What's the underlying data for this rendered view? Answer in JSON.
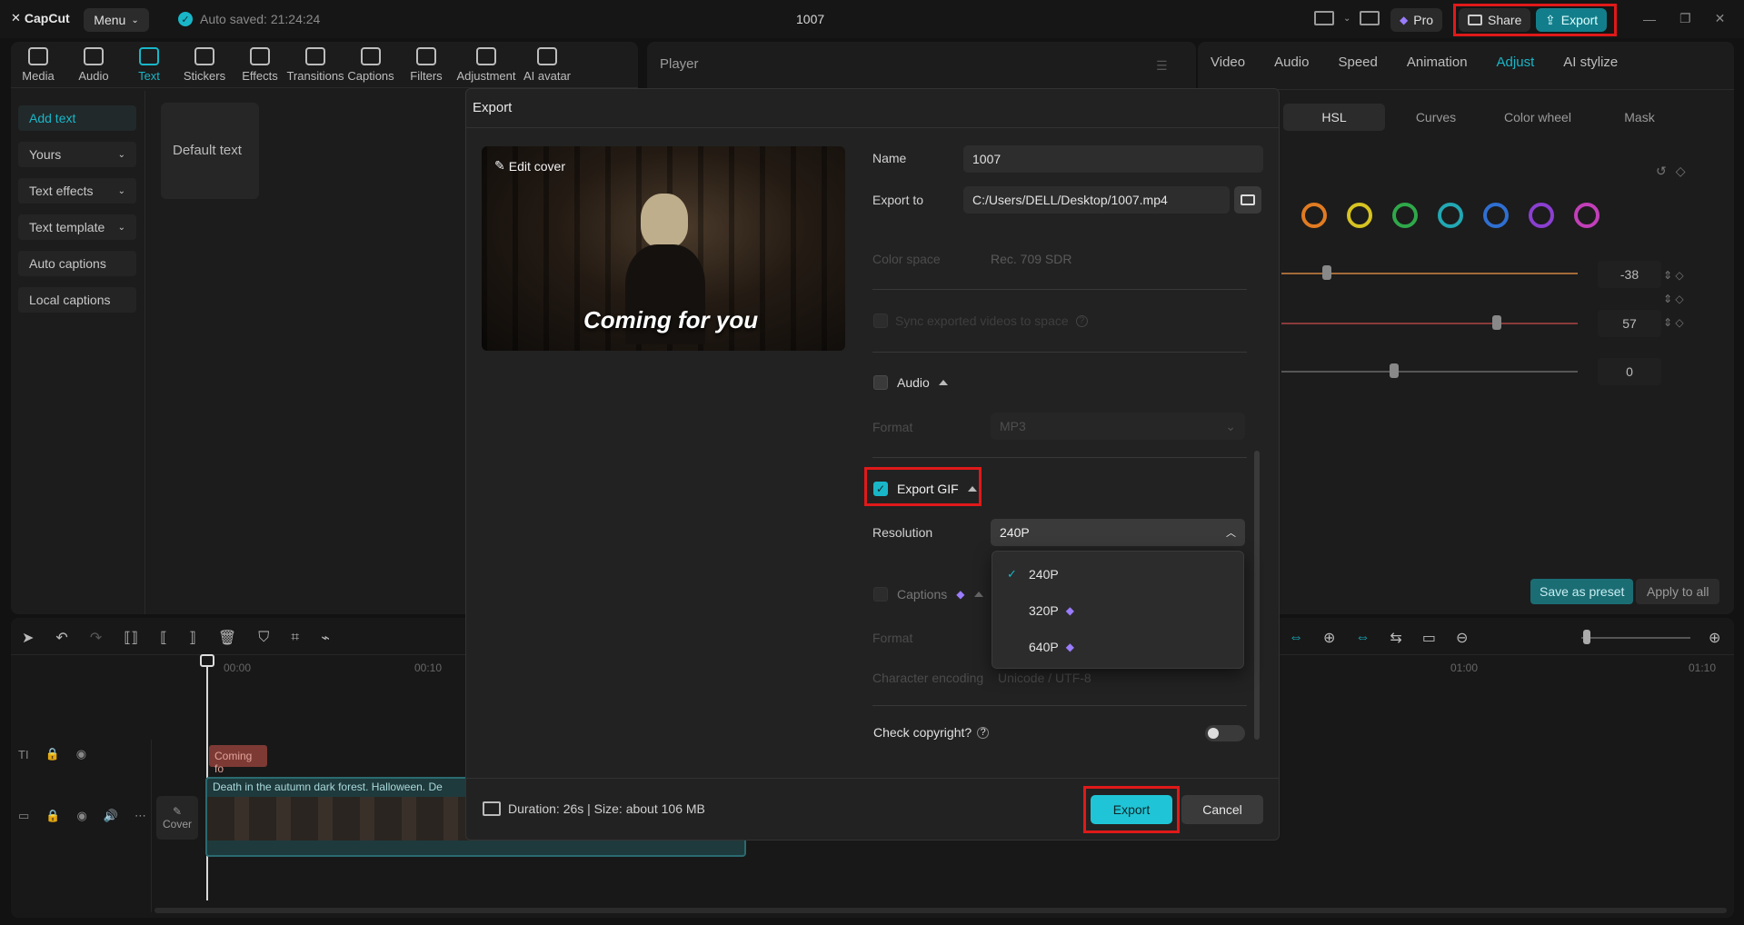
{
  "app": {
    "logo": "CapCut",
    "menu_label": "Menu",
    "autosave": "Auto saved: 21:24:24",
    "project_title": "1007",
    "pro_label": "Pro",
    "share_label": "Share",
    "export_label": "Export"
  },
  "toolbar": {
    "tools": [
      {
        "label": "Media",
        "icon": "media-icon"
      },
      {
        "label": "Audio",
        "icon": "audio-icon"
      },
      {
        "label": "Text",
        "icon": "text-icon",
        "active": true
      },
      {
        "label": "Stickers",
        "icon": "sticker-icon"
      },
      {
        "label": "Effects",
        "icon": "effects-icon"
      },
      {
        "label": "Transitions",
        "icon": "transitions-icon"
      },
      {
        "label": "Captions",
        "icon": "captions-icon"
      },
      {
        "label": "Filters",
        "icon": "filters-icon"
      },
      {
        "label": "Adjustment",
        "icon": "adjustment-icon"
      },
      {
        "label": "AI avatar",
        "icon": "ai-avatar-icon"
      }
    ]
  },
  "sidebar": {
    "items": [
      {
        "label": "Add text",
        "active": true
      },
      {
        "label": "Yours",
        "chevron": true
      },
      {
        "label": "Text effects",
        "chevron": true
      },
      {
        "label": "Text template",
        "chevron": true
      },
      {
        "label": "Auto captions"
      },
      {
        "label": "Local captions"
      }
    ],
    "default_text_card": "Default text"
  },
  "player": {
    "title": "Player"
  },
  "right_panel": {
    "tabs": [
      "Video",
      "Audio",
      "Speed",
      "Animation",
      "Adjust",
      "AI stylize"
    ],
    "active_tab": "Adjust",
    "subtabs": [
      "HSL",
      "Curves",
      "Color wheel",
      "Mask"
    ],
    "ring_colors": [
      "#e07b22",
      "#d6c321",
      "#2fa84a",
      "#22a7b3",
      "#2f6fd1",
      "#8a3fd1",
      "#c23fb8"
    ],
    "slider_values": [
      "-38",
      "57",
      "0"
    ],
    "save_preset": "Save as preset",
    "apply_all": "Apply to all"
  },
  "timeline": {
    "ticks": [
      "00:00",
      "00:10",
      "01:00",
      "01:10"
    ],
    "text_clip": "Coming fo",
    "video_clip": "Death in the autumn dark forest. Halloween. De",
    "cover_label": "Cover"
  },
  "dialog": {
    "title": "Export",
    "edit_cover": "Edit cover",
    "preview_caption": "Coming for you",
    "name_label": "Name",
    "name_value": "1007",
    "export_to_label": "Export to",
    "export_to_value": "C:/Users/DELL/Desktop/1007.mp4",
    "color_space_label": "Color space",
    "color_space_value": "Rec. 709 SDR",
    "sync_label": "Sync exported videos to space",
    "audio_label": "Audio",
    "format_label": "Format",
    "format_value": "MP3",
    "gif_label": "Export GIF",
    "resolution_label": "Resolution",
    "resolution_value": "240P",
    "resolution_options": [
      {
        "label": "240P",
        "selected": true,
        "pro": false
      },
      {
        "label": "320P",
        "selected": false,
        "pro": true
      },
      {
        "label": "640P",
        "selected": false,
        "pro": true
      }
    ],
    "captions_label": "Captions",
    "captions_format_label": "Format",
    "char_encoding_label": "Character encoding",
    "char_encoding_value": "Unicode / UTF-8",
    "copyright_label": "Check copyright?",
    "duration_info": "Duration: 26s | Size: about 106 MB",
    "export_button": "Export",
    "cancel_button": "Cancel"
  }
}
